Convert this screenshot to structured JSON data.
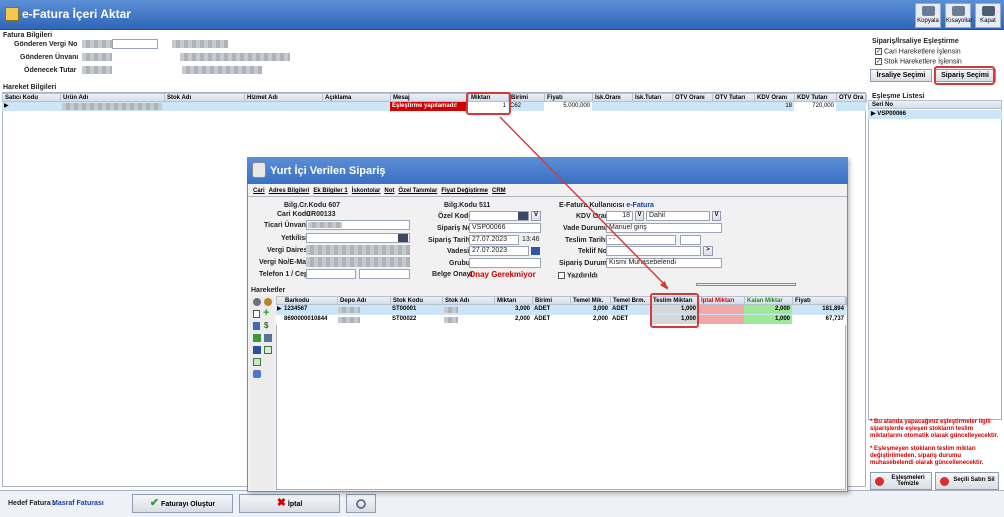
{
  "window": {
    "title": "e-Fatura İçeri Aktar"
  },
  "toolbar": {
    "kopyala": "Kopyala",
    "kisayollar": "Kısayollar",
    "kapat": "Kapat"
  },
  "fatura": {
    "section": "Fatura Bilgileri",
    "vergi_no_label": "Gönderen Vergi No",
    "unvan_label": "Gönderen Ünvanı",
    "tutar_label": "Ödenecek Tutar"
  },
  "eslesme": {
    "section": "Sipariş/İrsaliye Eşleştirme",
    "cari_chk": "Cari Hareketlere İşlensin",
    "stok_chk": "Stok Hareketlere İşlensin",
    "irsaliye_btn": "İrsaliye Seçimi",
    "siparis_btn": "Sipariş Seçimi"
  },
  "hareket": {
    "section": "Hareket Bilgileri",
    "cols": [
      "Satıcı Kodu",
      "Ürün Adı",
      "Stok Adı",
      "Hizmet Adı",
      "Açıklama",
      "Mesaj",
      "Miktarı",
      "Birimi",
      "Fiyatı",
      "İsk.Oranı",
      "İsk.Tutarı",
      "ÖTV Oranı",
      "ÖTV Tutarı",
      "KDV Oranı",
      "KDV Tutarı",
      "ÖTV Ora"
    ],
    "row": {
      "mesaj": "Eşleştirme yapılamadı!",
      "miktar": "1",
      "birim": "C62",
      "fiyat": "5.000,000",
      "kdv": "18",
      "kdv_tutar": "720,000"
    }
  },
  "eslesme_listesi": {
    "title": "Eşleşme Listesi",
    "col": "Seri No",
    "item": "VSP00066"
  },
  "notes": {
    "text1": "* Bu alanda yapacağınız eşleştirmeler ilgili siparişlerde eşleşen stokların teslim miktarlarını otomatik olarak güncelleyecektir.",
    "text2": "* Eşleşmeyen stokların teslim miktarı değiştirilmeden, sipariş durumu muhasebelendi olarak güncellenecektir."
  },
  "right_btns": {
    "temizle": "Eşleşmeleri Temizle",
    "sil": "Seçili Satırı Sil"
  },
  "bottom": {
    "hedef_label": "Hedef Fatura :",
    "hedef_value": "Masraf Faturası",
    "olustur": "Faturayı Oluştur",
    "iptal": "İptal"
  },
  "dialog": {
    "title": "Yurt İçi Verilen Sipariş",
    "tabs": [
      "Cari",
      "Adres Bilgileri",
      "Ek Bilgiler 1",
      "İskontolar",
      "Not",
      "Özel Tanımlar",
      "Fiyat Değiştirme",
      "CRM"
    ],
    "bilg_cr_kodu": "Bilg.Cr.Kodu 607",
    "bilg_kodu": "Bilg.Kodu 511",
    "efatura": "E-Fatura Kullanıcısı",
    "efatura_val": "e-Fatura",
    "cari_kodu_label": "Cari Kodu",
    "cari_kodu": "CR00133",
    "ticari_label": "Ticari Ünvanı",
    "yetkili_label": "Yetkilisi",
    "vergi_dairesi_label": "Vergi Dairesi",
    "vergi_no_label": "Vergi No/E-Mail",
    "telefon_label": "Telefon 1 / Cep",
    "ozel_kodu_label": "Özel Kodu",
    "siparis_no_label": "Sipariş No",
    "siparis_no": "VSP00066",
    "siparis_tarihi_label": "Sipariş Tarihi",
    "siparis_tarihi": "27.07.2023",
    "saat": "13:46",
    "vadesi_label": "Vadesi",
    "vadesi": "27.07.2023",
    "grubu_label": "Grubu",
    "belge_onayi_label": "Belge Onayı",
    "belge_onayi": "Onay Gerekmiyor",
    "kdv_orani_label": "KDV Oranı",
    "kdv_orani": "18",
    "kdv_dahil": "Dahil",
    "vade_durumu_label": "Vade Durumu",
    "vade_durumu": "Manuel giriş",
    "teslim_tarihi_label": "Teslim Tarihi",
    "teslim_tarihi": "- -",
    "teklif_no_label": "Teklif No",
    "siparis_durumu_label": "Sipariş Durumu",
    "siparis_durumu": "Kısmi Muhasebelendi",
    "yazdirildi": "Yazdırıldı",
    "hareketler": "Hareketler",
    "cols": [
      "Barkodu",
      "Depo Adı",
      "Stok Kodu",
      "Stok Adı",
      "Miktarı",
      "Birimi",
      "Temel Mik.",
      "Temel Brm.",
      "Teslim Miktarı",
      "İptal Miktarı",
      "Kalan Miktar",
      "Fiyatı"
    ],
    "rows": [
      {
        "barkod": "1234567",
        "stok": "ST00001",
        "miktar": "3,000",
        "birim": "ADET",
        "temel": "3,000",
        "tbrm": "ADET",
        "teslim": "1,000",
        "kalan": "2,000",
        "fiyat": "181,894"
      },
      {
        "barkod": "8690000010844",
        "stok": "ST00022",
        "miktar": "2,000",
        "birim": "ADET",
        "temel": "2,000",
        "tbrm": "ADET",
        "teslim": "1,000",
        "kalan": "1,000",
        "fiyat": "67,737"
      }
    ]
  },
  "colors": {
    "title": "#2f66b8",
    "highlight": "#d43a3a",
    "kalan": "#9ee89a",
    "iptal": "#f4a7a7"
  }
}
